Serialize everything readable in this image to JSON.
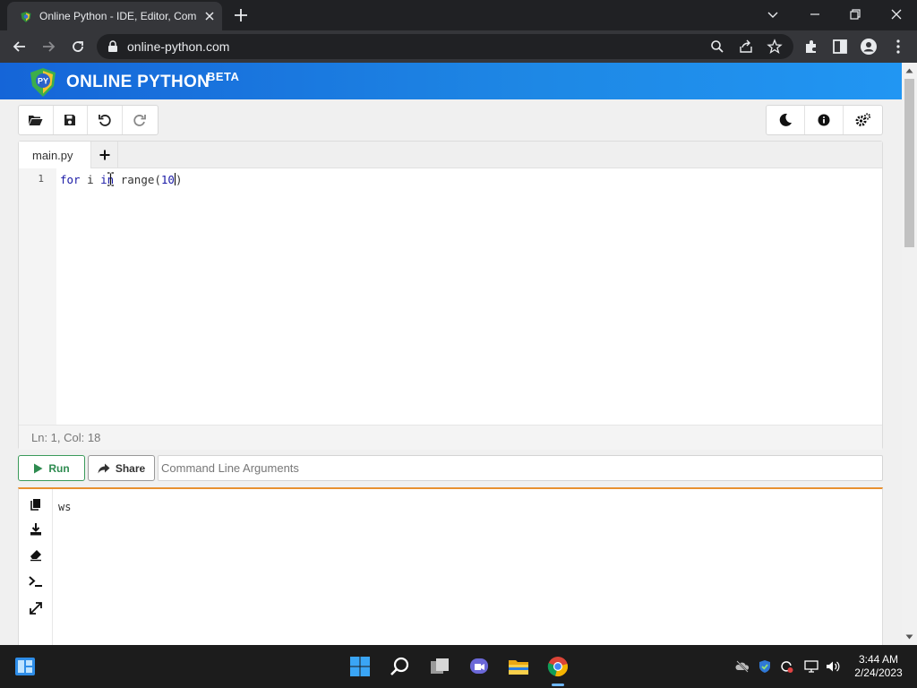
{
  "browser": {
    "tab_title": "Online Python - IDE, Editor, Com",
    "url": "online-python.com"
  },
  "brand": {
    "logo_text": "PY",
    "name": "ONLINE PYTHON",
    "beta": "BETA",
    "gradient_start": "#1565d8",
    "gradient_end": "#2196f3"
  },
  "toolbar_left": [
    "folder-open-icon",
    "save-icon",
    "undo-icon",
    "redo-icon"
  ],
  "toolbar_right": [
    "moon-icon",
    "info-icon",
    "settings-icon"
  ],
  "editor": {
    "file_tab": "main.py",
    "add_tab": "+",
    "line_number": "1",
    "code_parts": [
      "for",
      " i ",
      "in",
      " range(",
      "10",
      ")"
    ],
    "status": "Ln: 1,  Col: 18"
  },
  "actions": {
    "run_label": "Run",
    "share_label": "Share",
    "args_placeholder": "Command Line Arguments",
    "run_color": "#2e8b50"
  },
  "output": {
    "text": "ws",
    "accent": "#e8902f",
    "icons": [
      "copy-icon",
      "download-icon",
      "eraser-icon",
      "terminal-icon",
      "expand-icon"
    ]
  },
  "taskbar": {
    "time": "3:44 AM",
    "date": "2/24/2023"
  }
}
